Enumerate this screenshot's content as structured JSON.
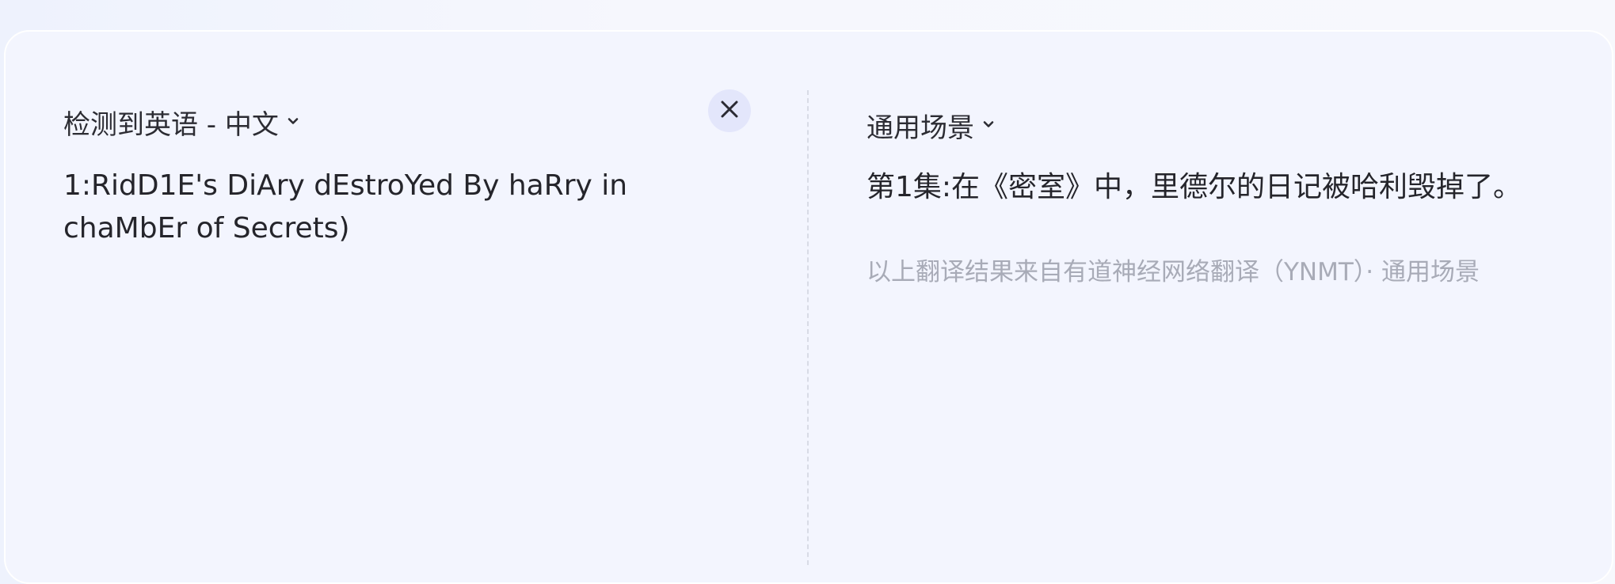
{
  "source_panel": {
    "language_selector": "检测到英语 - 中文",
    "input_text": "1:RidD1E's DiAry dEstroYed By haRry in chaMbEr of Secrets)"
  },
  "target_panel": {
    "scene_selector": "通用场景",
    "translation": "第1集:在《密室》中，里德尔的日记被哈利毁掉了。",
    "attribution": "以上翻译结果来自有道神经网络翻译（YNMT）· 通用场景"
  },
  "icons": {
    "close": "close-icon",
    "dropdown": "chevron-down-icon"
  },
  "colors": {
    "card_background": "#f3f5fe",
    "text_primary": "#25252b",
    "text_muted": "#a8abb7",
    "close_button_bg": "#e3e6fb"
  }
}
